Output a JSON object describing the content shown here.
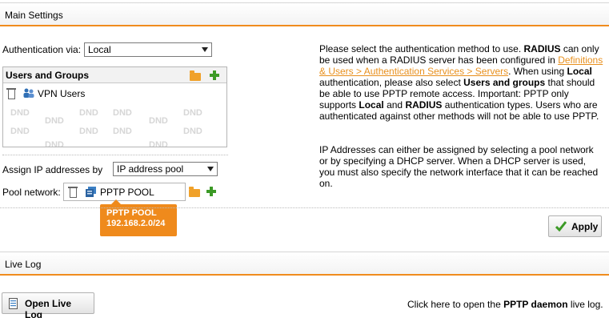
{
  "main_settings": {
    "title": "Main Settings",
    "auth_label": "Authentication via:",
    "auth_value": "Local",
    "users_groups": {
      "title": "Users and Groups",
      "items": [
        {
          "label": "VPN Users"
        }
      ],
      "placeholder": "DND"
    },
    "assign_ip_label": "Assign IP addresses by",
    "assign_ip_value": "IP address pool",
    "pool_network_label": "Pool network:",
    "pool_network_value": "PPTP POOL",
    "tooltip": {
      "name": "PPTP POOL",
      "network": "192.168.2.0/24"
    },
    "help": {
      "p1_a": "Please select the authentication method to use.",
      "p1_b": "RADIUS",
      "p1_c": "can only be used when a RADIUS server has been configured in",
      "p1_link": "Definitions & Users > Authentication Services > Servers",
      "p1_d": ". When using",
      "p1_e": "Local",
      "p1_f": "authentication, please also select",
      "p1_g": "Users and groups",
      "p1_h": "that should be able to use PPTP remote access. Important: PPTP only supports",
      "p1_i": "Local",
      "p1_j": "and",
      "p1_k": "RADIUS",
      "p1_l": "authentication types. Users who are authenticated against other methods will not be able to use PPTP.",
      "p2": "IP Addresses can either be assigned by selecting a pool network or by specifying a DHCP server. When a DHCP server is used, you must also specify the network interface that it can be reached on."
    },
    "apply_label": "Apply"
  },
  "live_log": {
    "title": "Live Log",
    "open_button": "Open Live Log",
    "hint_a": "Click here to open the",
    "hint_b": "PPTP daemon",
    "hint_c": "live log."
  }
}
